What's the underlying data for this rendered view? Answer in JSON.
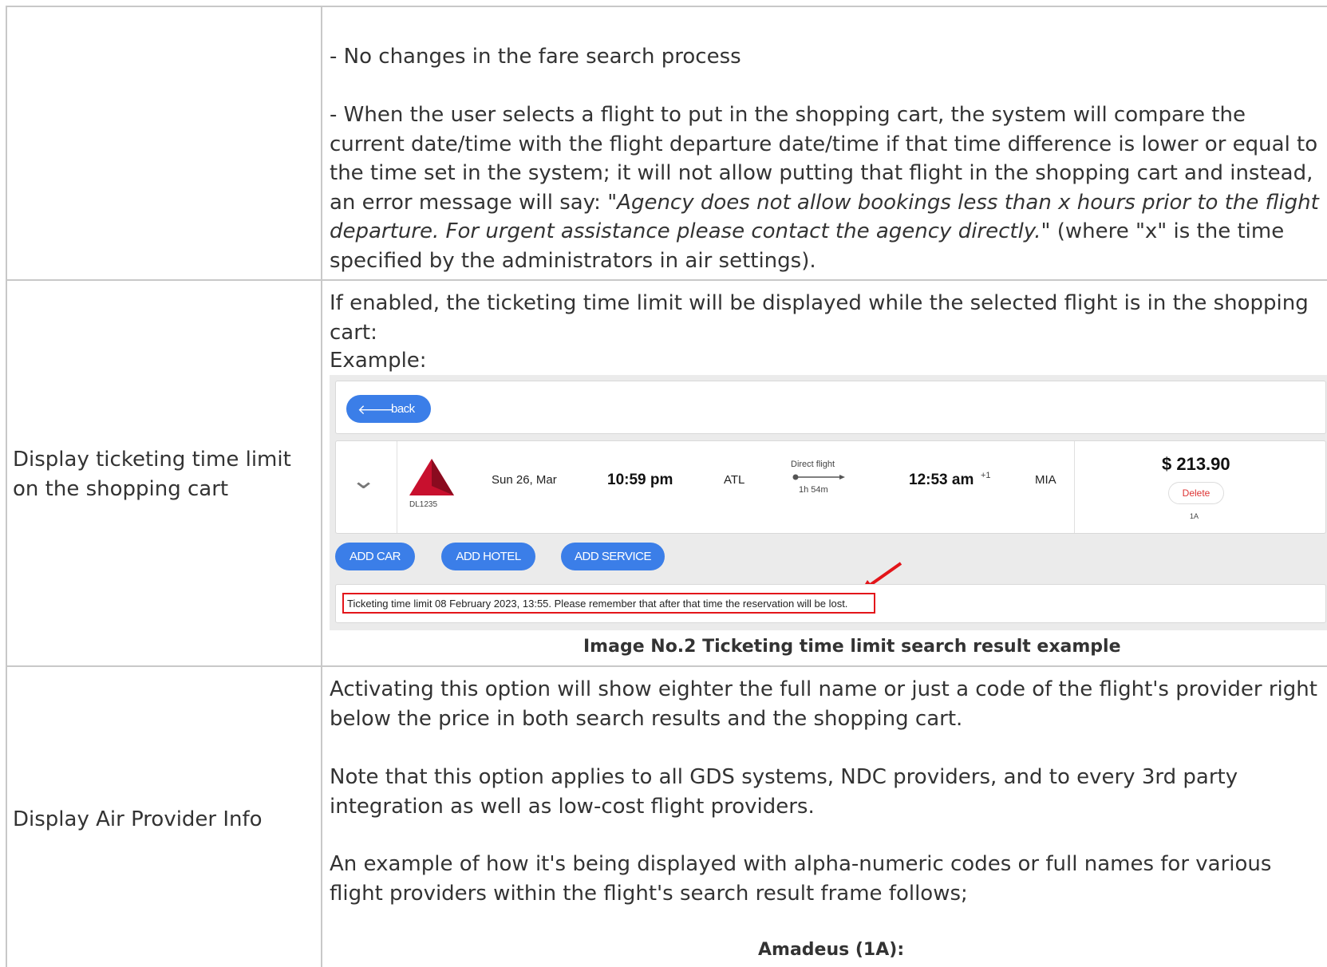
{
  "rows": [
    {
      "label": "",
      "paragraphs": [
        "- No changes in the fare search process",
        "- When the user selects a flight to put in the shopping cart, the system will compare the current date/time with the flight departure date/time if that time difference is lower or equal to the time set in the system; it will not allow putting that flight in the shopping cart and instead, an error message will say: \""
      ],
      "quote_italic": "Agency does not allow bookings less than x hours prior to the flight departure. For urgent assistance please contact the agency directly.",
      "quote_tail": "\" (where \"x\" is the time specified by the administrators in air settings)."
    },
    {
      "label": "Display ticketing time limit on the shopping cart",
      "paragraphs": [
        "If enabled, the ticketing time limit will be displayed while the selected flight is in the shopping cart:",
        "Example:"
      ],
      "caption": "Image No.2 Ticketing time limit search result example"
    },
    {
      "label": "Display Air Provider Info",
      "paragraphs": [
        "Activating this option will show eighter the full name or just a code of the flight's provider right below the price in both search results and the shopping cart.",
        "Note that this option applies to all GDS systems, NDC providers, and to every 3rd party integration as well as low-cost flight providers.",
        "An example of how it's being displayed with alpha-numeric codes or full names for various flight providers within the flight's search result frame follows;"
      ],
      "subheading": "Amadeus (1A):"
    }
  ],
  "example": {
    "back_label": "back",
    "flight_number": "DL1235",
    "date": "Sun 26, Mar",
    "depart_time": "10:59 pm",
    "origin": "ATL",
    "flight_type": "Direct flight",
    "duration": "1h 54m",
    "arrive_time": "12:53 am",
    "day_offset": "+1",
    "destination": "MIA",
    "price": "$ 213.90",
    "delete_label": "Delete",
    "provider_code": "1A",
    "add_buttons": [
      "ADD CAR",
      "ADD HOTEL",
      "ADD SERVICE"
    ],
    "time_limit_text": "Ticketing time limit 08 February 2023, 13:55. Please remember that after that time the reservation will be lost."
  },
  "colors": {
    "accent_blue": "#3b7ee8",
    "highlight_red": "#e3151a",
    "delta_red": "#c8102e"
  }
}
